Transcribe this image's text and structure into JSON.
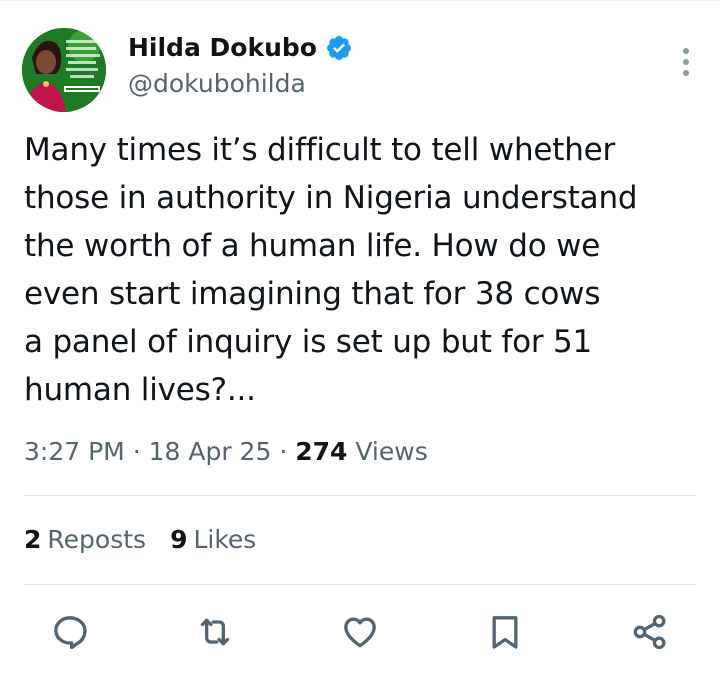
{
  "tweet": {
    "author": {
      "display_name": "Hilda Dokubo",
      "handle": "@dokubohilda",
      "verified": true,
      "avatar": "avatar-photo"
    },
    "text": "Many times it’s difficult to tell whether\nthose in authority in Nigeria understand\nthe worth of a human life. How do we\neven start imagining that for 38 cows\na panel of inquiry is set up but for 51\nhuman lives?...",
    "meta": {
      "time": "3:27 PM",
      "separator": "·",
      "date": "18 Apr 25",
      "views_count": "274",
      "views_label": "Views"
    },
    "stats": {
      "reposts_count": "2",
      "reposts_label": "Reposts",
      "likes_count": "9",
      "likes_label": "Likes"
    },
    "actions": [
      {
        "name": "reply",
        "icon": "reply-icon"
      },
      {
        "name": "repost",
        "icon": "repost-icon"
      },
      {
        "name": "like",
        "icon": "heart-icon"
      },
      {
        "name": "bookmark",
        "icon": "bookmark-icon"
      },
      {
        "name": "share",
        "icon": "share-icon"
      }
    ]
  },
  "colors": {
    "text_primary": "#0f1419",
    "text_secondary": "#536471",
    "verified_blue": "#1d9bf0",
    "divider": "#e3e6e8"
  }
}
